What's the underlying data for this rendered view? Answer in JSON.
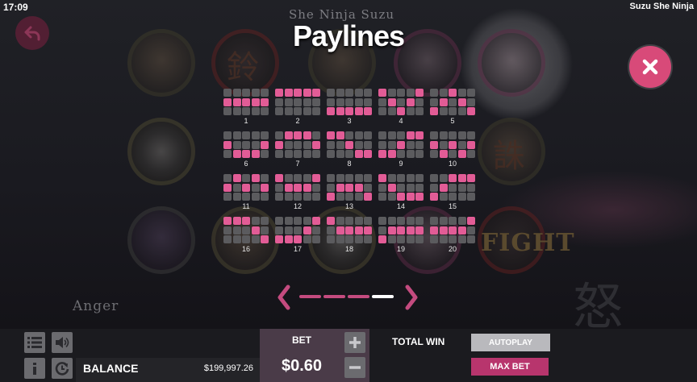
{
  "status_bar": {
    "time": "17:09",
    "game_title": "Suzu She Ninja"
  },
  "background": {
    "logo": "She Ninja Suzu",
    "anger_label": "Anger",
    "anger_kanji": "怒",
    "fight_label": "FIGHT",
    "glyph_bell": "鈴",
    "glyph_kill": "誅"
  },
  "paylines_screen": {
    "title": "Paylines",
    "paylines": [
      {
        "number": "1",
        "rows": [
          [
            0,
            0,
            0,
            0,
            0
          ],
          [
            1,
            1,
            1,
            1,
            1
          ],
          [
            0,
            0,
            0,
            0,
            0
          ]
        ]
      },
      {
        "number": "2",
        "rows": [
          [
            1,
            1,
            1,
            1,
            1
          ],
          [
            0,
            0,
            0,
            0,
            0
          ],
          [
            0,
            0,
            0,
            0,
            0
          ]
        ]
      },
      {
        "number": "3",
        "rows": [
          [
            0,
            0,
            0,
            0,
            0
          ],
          [
            0,
            0,
            0,
            0,
            0
          ],
          [
            1,
            1,
            1,
            1,
            1
          ]
        ]
      },
      {
        "number": "4",
        "rows": [
          [
            1,
            0,
            0,
            0,
            1
          ],
          [
            0,
            1,
            0,
            1,
            0
          ],
          [
            0,
            0,
            1,
            0,
            0
          ]
        ]
      },
      {
        "number": "5",
        "rows": [
          [
            0,
            0,
            1,
            0,
            0
          ],
          [
            0,
            1,
            0,
            1,
            0
          ],
          [
            1,
            0,
            0,
            0,
            1
          ]
        ]
      },
      {
        "number": "6",
        "rows": [
          [
            0,
            0,
            0,
            0,
            0
          ],
          [
            1,
            0,
            0,
            0,
            1
          ],
          [
            0,
            1,
            1,
            1,
            0
          ]
        ]
      },
      {
        "number": "7",
        "rows": [
          [
            0,
            1,
            1,
            1,
            0
          ],
          [
            1,
            0,
            0,
            0,
            1
          ],
          [
            0,
            0,
            0,
            0,
            0
          ]
        ]
      },
      {
        "number": "8",
        "rows": [
          [
            1,
            1,
            0,
            0,
            0
          ],
          [
            0,
            0,
            1,
            0,
            0
          ],
          [
            0,
            0,
            0,
            1,
            1
          ]
        ]
      },
      {
        "number": "9",
        "rows": [
          [
            0,
            0,
            0,
            1,
            1
          ],
          [
            0,
            0,
            1,
            0,
            0
          ],
          [
            1,
            1,
            0,
            0,
            0
          ]
        ]
      },
      {
        "number": "10",
        "rows": [
          [
            0,
            0,
            0,
            0,
            0
          ],
          [
            1,
            0,
            1,
            0,
            1
          ],
          [
            0,
            1,
            0,
            1,
            0
          ]
        ]
      },
      {
        "number": "11",
        "rows": [
          [
            0,
            1,
            0,
            1,
            0
          ],
          [
            1,
            0,
            1,
            0,
            1
          ],
          [
            0,
            0,
            0,
            0,
            0
          ]
        ]
      },
      {
        "number": "12",
        "rows": [
          [
            1,
            0,
            0,
            0,
            1
          ],
          [
            0,
            1,
            1,
            1,
            0
          ],
          [
            0,
            0,
            0,
            0,
            0
          ]
        ]
      },
      {
        "number": "13",
        "rows": [
          [
            0,
            0,
            0,
            0,
            0
          ],
          [
            0,
            1,
            1,
            1,
            0
          ],
          [
            1,
            0,
            0,
            0,
            1
          ]
        ]
      },
      {
        "number": "14",
        "rows": [
          [
            1,
            0,
            0,
            0,
            0
          ],
          [
            0,
            1,
            0,
            0,
            0
          ],
          [
            0,
            0,
            1,
            1,
            1
          ]
        ]
      },
      {
        "number": "15",
        "rows": [
          [
            0,
            0,
            1,
            1,
            1
          ],
          [
            0,
            1,
            0,
            0,
            0
          ],
          [
            1,
            0,
            0,
            0,
            0
          ]
        ]
      },
      {
        "number": "16",
        "rows": [
          [
            1,
            1,
            1,
            0,
            0
          ],
          [
            0,
            0,
            0,
            1,
            0
          ],
          [
            0,
            0,
            0,
            0,
            1
          ]
        ]
      },
      {
        "number": "17",
        "rows": [
          [
            0,
            0,
            0,
            0,
            1
          ],
          [
            0,
            0,
            0,
            1,
            0
          ],
          [
            1,
            1,
            1,
            0,
            0
          ]
        ]
      },
      {
        "number": "18",
        "rows": [
          [
            1,
            0,
            0,
            0,
            0
          ],
          [
            0,
            1,
            1,
            1,
            1
          ],
          [
            0,
            0,
            0,
            0,
            0
          ]
        ]
      },
      {
        "number": "19",
        "rows": [
          [
            0,
            0,
            0,
            0,
            0
          ],
          [
            0,
            1,
            1,
            1,
            1
          ],
          [
            1,
            0,
            0,
            0,
            0
          ]
        ]
      },
      {
        "number": "20",
        "rows": [
          [
            0,
            0,
            0,
            0,
            1
          ],
          [
            1,
            1,
            1,
            1,
            0
          ],
          [
            0,
            0,
            0,
            0,
            0
          ]
        ]
      }
    ],
    "pagination": {
      "pages": 4,
      "current": 4
    }
  },
  "controls": {
    "balance_label": "BALANCE",
    "balance_value": "$199,997.26",
    "bet_label": "BET",
    "bet_value": "$0.60",
    "total_win_label": "TOTAL WIN",
    "autoplay_label": "AUTOPLAY",
    "max_bet_label": "MAX BET"
  },
  "colors": {
    "accent_pink": "#e25c96",
    "inactive_cell": "#5b5b5e",
    "close_button": "#d84a79",
    "max_bet": "#b8356d"
  },
  "icons": [
    "back-icon",
    "close-icon",
    "chevron-left-icon",
    "chevron-right-icon",
    "menu-icon",
    "sound-icon",
    "info-icon",
    "history-icon",
    "plus-icon",
    "minus-icon"
  ]
}
